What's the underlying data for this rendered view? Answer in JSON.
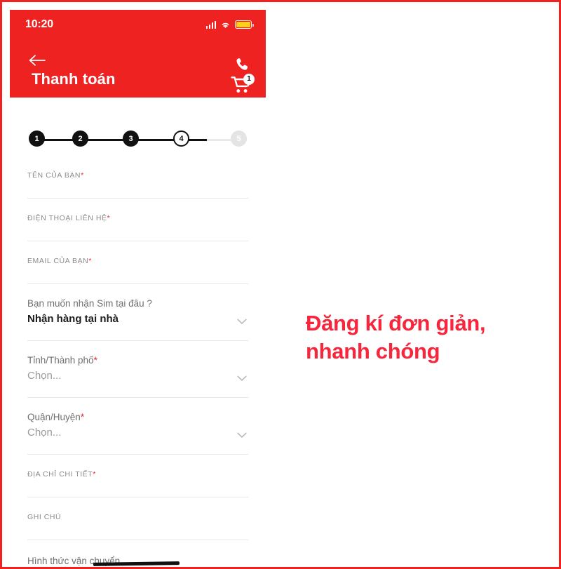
{
  "theme": {
    "brand_red": "#ef2222",
    "promo_red": "#f8263c",
    "required_red": "#e8272c",
    "step_done": "#111111",
    "step_todo": "#e4e4e4",
    "battery_yellow": "#fdd019"
  },
  "phone": {
    "status_bar": {
      "time": "10:20",
      "signal_icon": "signal-bars-icon",
      "wifi_icon": "wifi-icon",
      "battery_icon": "battery-icon"
    },
    "header": {
      "back_icon": "back-arrow-icon",
      "title": "Thanh toán",
      "phone_icon": "phone-call-icon",
      "cart_icon": "shopping-cart-icon",
      "cart_badge": "1"
    },
    "stepper": {
      "steps": [
        {
          "label": "1",
          "state": "done"
        },
        {
          "label": "2",
          "state": "done"
        },
        {
          "label": "3",
          "state": "done"
        },
        {
          "label": "4",
          "state": "current"
        },
        {
          "label": "5",
          "state": "todo"
        }
      ]
    },
    "form": {
      "fields": [
        {
          "label": "TÊN CỦA BẠN",
          "required": "*",
          "value": "",
          "type": "text"
        },
        {
          "label": "ĐIỆN THOẠI LIÊN HỆ",
          "required": "*",
          "value": "",
          "type": "text"
        },
        {
          "label": "EMAIL CỦA BẠN",
          "required": "*",
          "value": "",
          "type": "text"
        }
      ],
      "delivery": {
        "label": "Bạn muốn nhận Sim tại đâu ?",
        "value": "Nhận hàng tại nhà",
        "chevron_icon": "chevron-down-icon"
      },
      "province": {
        "label": "Tỉnh/Thành phố",
        "required": "*",
        "placeholder": "Chọn...",
        "chevron_icon": "chevron-down-icon"
      },
      "district": {
        "label": "Quận/Huyện",
        "required": "*",
        "placeholder": "Chọn...",
        "chevron_icon": "chevron-down-icon"
      },
      "address": {
        "label": "ĐỊA CHỈ CHI TIẾT",
        "required": "*",
        "value": ""
      },
      "note": {
        "label": "GHI CHÚ",
        "required": "",
        "value": ""
      },
      "shipping": {
        "label": "Hình thức vận chuyển"
      }
    }
  },
  "promo": {
    "line1": "Đăng kí đơn giản,",
    "line2": "nhanh chóng"
  }
}
